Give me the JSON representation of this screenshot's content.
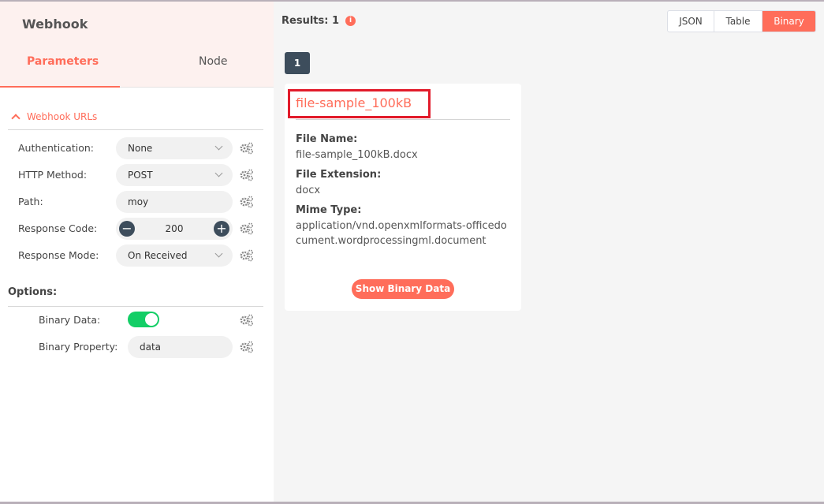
{
  "node": {
    "title": "Webhook",
    "tabs": [
      {
        "label": "Parameters",
        "active": true
      },
      {
        "label": "Node",
        "active": false
      }
    ]
  },
  "webhook_urls": {
    "label": "Webhook URLs"
  },
  "parameters": {
    "authentication": {
      "label": "Authentication:",
      "value": "None"
    },
    "http_method": {
      "label": "HTTP Method:",
      "value": "POST"
    },
    "path": {
      "label": "Path:",
      "value": "moy"
    },
    "response_code": {
      "label": "Response Code:",
      "value": "200",
      "minus": "−",
      "plus": "+"
    },
    "response_mode": {
      "label": "Response Mode:",
      "value": "On Received"
    }
  },
  "options": {
    "label": "Options:",
    "binary_data": {
      "label": "Binary Data:",
      "enabled": true
    },
    "binary_property": {
      "label": "Binary Property:",
      "value": "data"
    }
  },
  "results": {
    "label": "Results: 1",
    "info_icon_glyph": "i",
    "views": [
      {
        "label": "JSON",
        "active": false
      },
      {
        "label": "Table",
        "active": false
      },
      {
        "label": "Binary",
        "active": true
      }
    ],
    "page": "1"
  },
  "binary_card": {
    "title": "file-sample_100kB",
    "file_name_label": "File Name:",
    "file_name": "file-sample_100kB.docx",
    "file_extension_label": "File Extension:",
    "file_extension": "docx",
    "mime_type_label": "Mime Type:",
    "mime_type": "application/vnd.openxmlformats-officedocument.wordprocessingml.document",
    "show_button": "Show Binary Data"
  },
  "colors": {
    "accent": "#ff6d5a",
    "dark": "#3d4d5c",
    "toggle_on": "#13ce66",
    "highlight_box": "#e21b2b"
  },
  "icons": {
    "settings": "gears-icon",
    "collapse": "chevron-up-icon",
    "dropdown": "chevron-down-icon",
    "info": "info-icon"
  }
}
